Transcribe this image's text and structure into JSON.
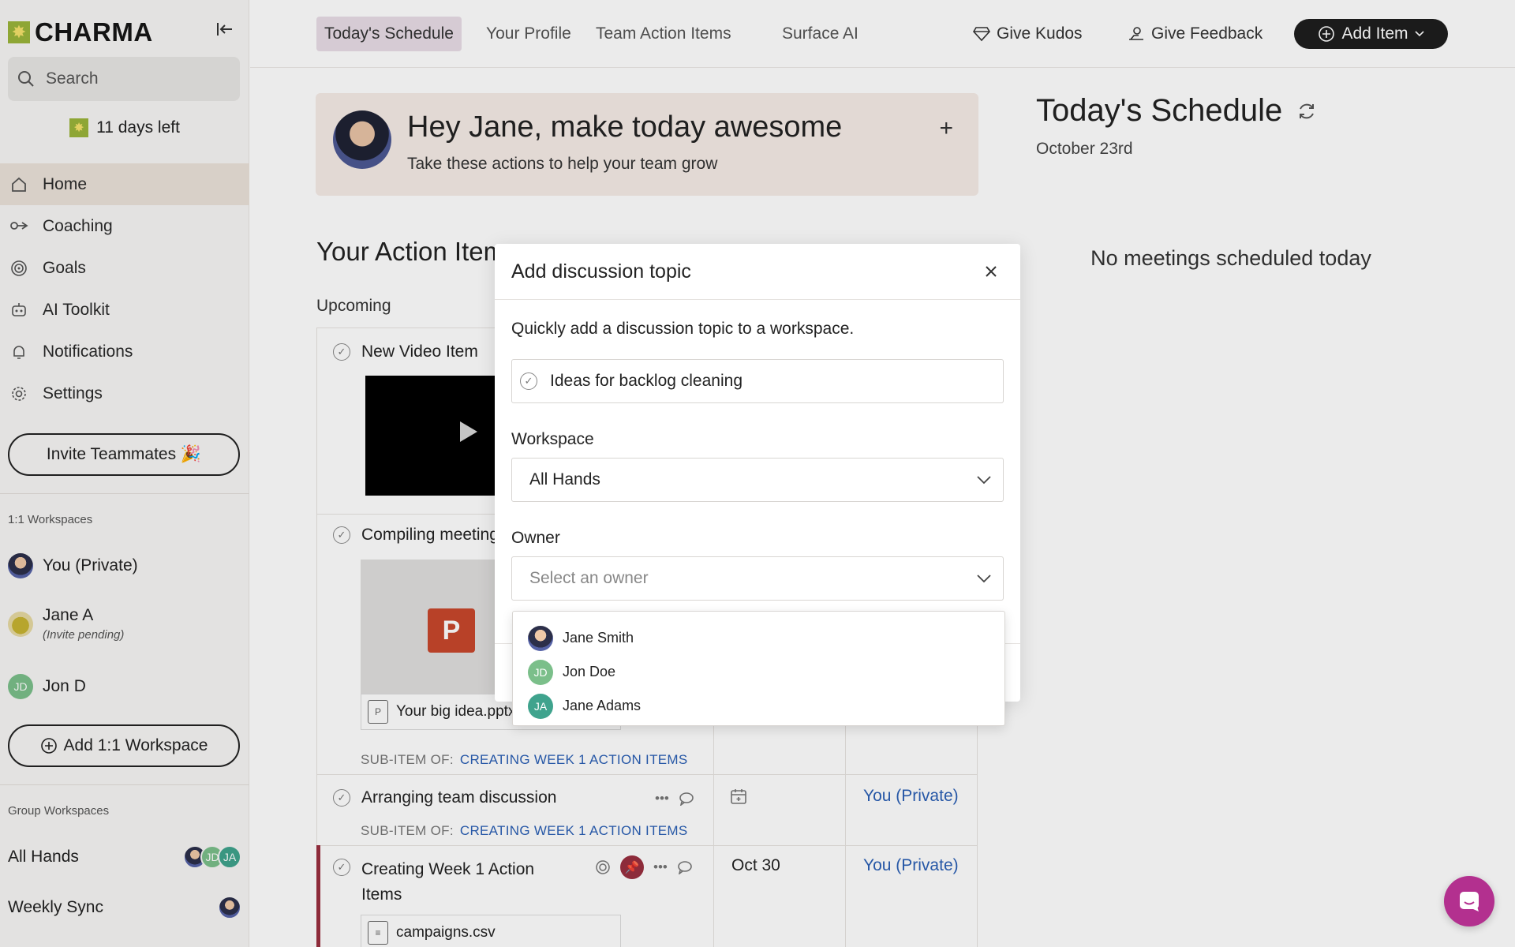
{
  "brand": {
    "name": "CHARMA"
  },
  "search": {
    "placeholder": "Search"
  },
  "trial": {
    "label": "11 days left"
  },
  "sidebar": {
    "nav": [
      {
        "label": "Home",
        "icon": "home-icon",
        "active": true
      },
      {
        "label": "Coaching",
        "icon": "coaching-icon"
      },
      {
        "label": "Goals",
        "icon": "target-icon"
      },
      {
        "label": "AI Toolkit",
        "icon": "robot-icon"
      },
      {
        "label": "Notifications",
        "icon": "bell-icon"
      },
      {
        "label": "Settings",
        "icon": "gear-icon"
      }
    ],
    "invite_label": "Invite Teammates 🎉",
    "one_on_one_label": "1:1 Workspaces",
    "one_on_one": [
      {
        "name": "You (Private)"
      },
      {
        "name": "Jane A",
        "sub": "(Invite pending)"
      },
      {
        "name": "Jon D",
        "initials": "JD"
      }
    ],
    "add_workspace_label": "Add 1:1 Workspace",
    "group_label": "Group Workspaces",
    "groups": [
      {
        "name": "All Hands",
        "avatars": [
          "",
          "JD",
          "JA"
        ]
      },
      {
        "name": "Weekly Sync"
      }
    ]
  },
  "topnav": {
    "tabs": [
      "Today's Schedule",
      "Your Profile",
      "Team Action Items",
      "Surface AI"
    ],
    "kudos_label": "Give Kudos",
    "feedback_label": "Give Feedback",
    "add_item_label": "Add Item"
  },
  "greeting": {
    "title": "Hey Jane, make today awesome",
    "subtitle": "Take these actions to help your team grow"
  },
  "schedule": {
    "title": "Today's Schedule",
    "date": "October 23rd",
    "empty": "No meetings scheduled today"
  },
  "action_items": {
    "title": "Your Action Items",
    "section": "Upcoming",
    "items": [
      {
        "title": "New Video Item"
      },
      {
        "title": "Compiling meetings",
        "file": "Your big idea.pptx",
        "sub_prefix": "SUB-ITEM OF:",
        "sub_link": "CREATING WEEK 1 ACTION ITEMS"
      },
      {
        "title": "Arranging team discussion",
        "sub_prefix": "SUB-ITEM OF:",
        "sub_link": "CREATING WEEK 1 ACTION ITEMS",
        "owner": "You (Private)"
      },
      {
        "title": "Creating Week 1 Action",
        "title2": "Items",
        "due": "Oct 30",
        "owner": "You (Private)",
        "file": "campaigns.csv"
      }
    ],
    "ppt_letter": "P"
  },
  "modal": {
    "title": "Add discussion topic",
    "description": "Quickly add a discussion topic to a workspace.",
    "topic_value": "Ideas for backlog cleaning",
    "workspace_label": "Workspace",
    "workspace_value": "All Hands",
    "owner_label": "Owner",
    "owner_placeholder": "Select an owner",
    "owner_options": [
      {
        "name": "Jane Smith"
      },
      {
        "name": "Jon Doe",
        "initials": "JD"
      },
      {
        "name": "Jane Adams",
        "initials": "JA"
      }
    ]
  },
  "colors": {
    "accent_pink": "#e9dde7",
    "link_blue": "#2a5fb5",
    "pin_red": "#9a2f3f",
    "chat_magenta": "#b3308f",
    "brand_green": "#9bb53a"
  }
}
